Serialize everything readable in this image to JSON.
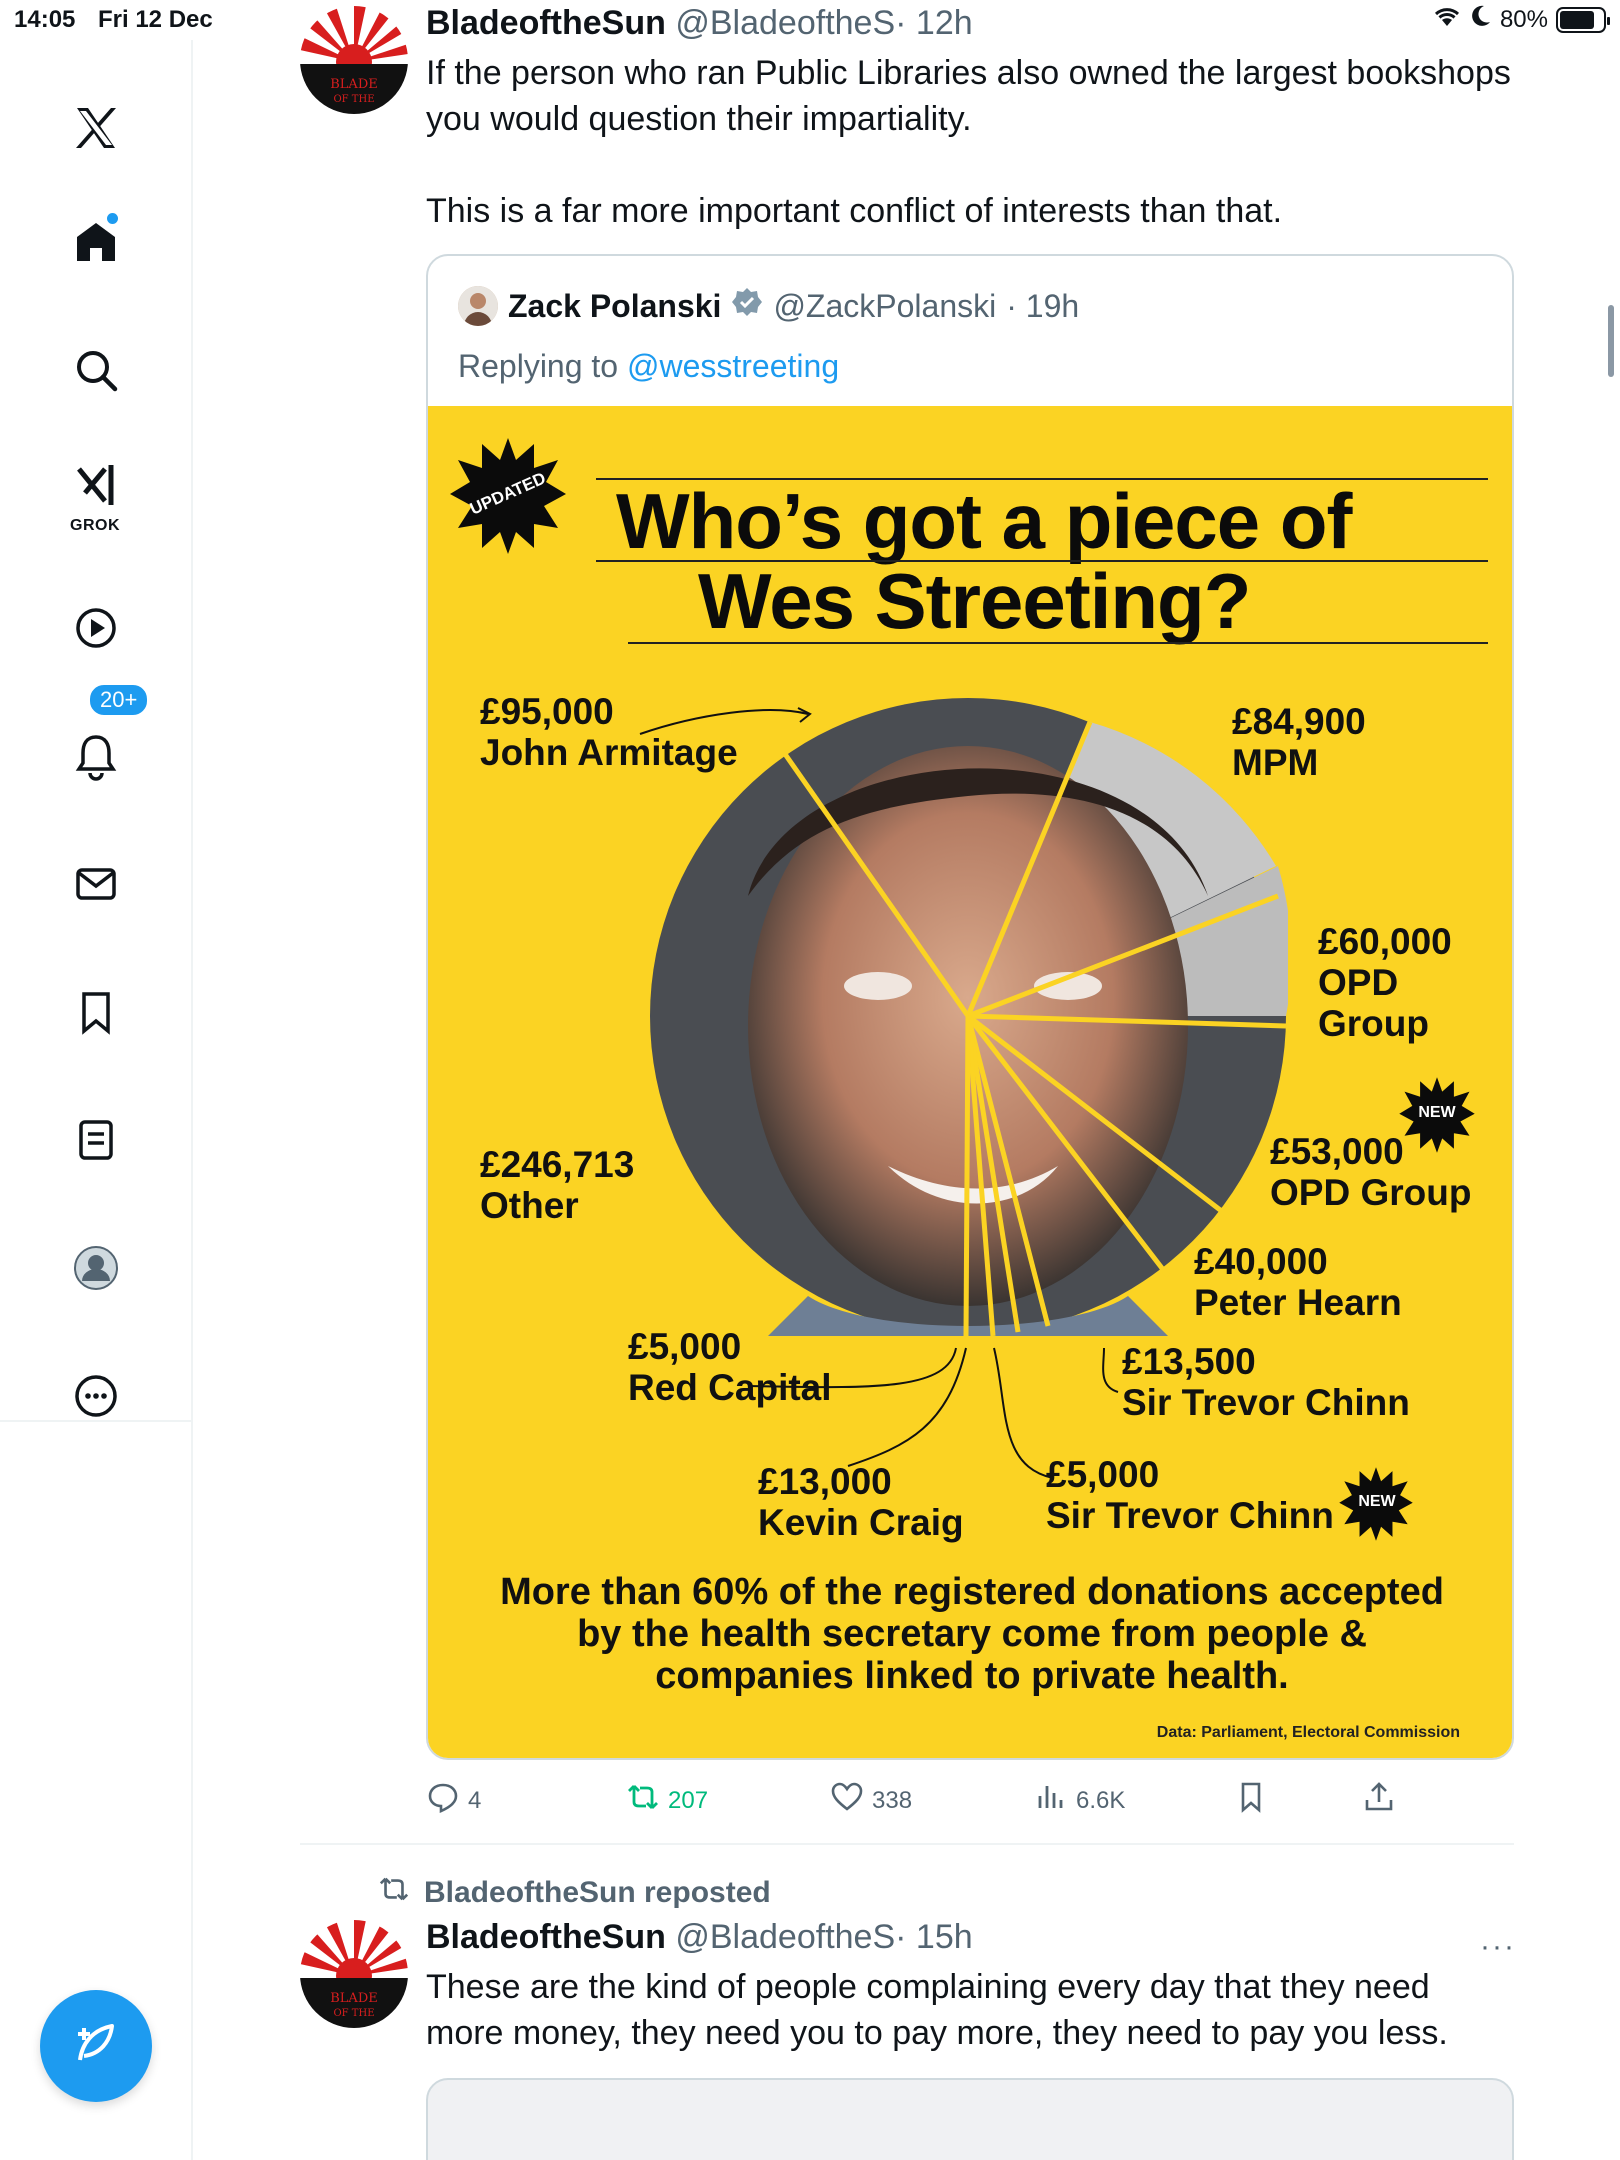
{
  "status_bar": {
    "time": "14:05",
    "date": "Fri 12 Dec",
    "battery": "80%",
    "battery_level": 0.8
  },
  "sidebar": {
    "items": [
      {
        "icon": "x-logo-icon"
      },
      {
        "icon": "home-icon",
        "has_dot": true
      },
      {
        "icon": "search-icon"
      },
      {
        "icon": "grok-icon",
        "label": "GROK"
      },
      {
        "icon": "video-icon"
      },
      {
        "icon": "notifications-icon",
        "badge": "20+"
      },
      {
        "icon": "messages-icon"
      },
      {
        "icon": "bookmarks-icon"
      },
      {
        "icon": "lists-icon"
      },
      {
        "icon": "profile-icon"
      },
      {
        "icon": "more-icon"
      }
    ],
    "compose_icon": "compose-icon"
  },
  "tweet1": {
    "name": "BladeoftheSun",
    "handle": "@BladeoftheS",
    "time": "· 12h",
    "text_line1": "If the person who ran Public Libraries also owned the largest bookshops",
    "text_line2": "you would question their impartiality.",
    "text_line3": "This is a far more important conflict of interests than that.",
    "avatar_text": "BLADE OF THE",
    "quote": {
      "name": "Zack Polanski",
      "handle": "@ZackPolanski",
      "time": "· 19h",
      "replying_prefix": "Replying to",
      "replying_to": "@wesstreeting",
      "poster": {
        "badge": "UPDATED",
        "title_line1": "Who’s got a piece of",
        "title_line2": "Wes Streeting?",
        "labels": [
          {
            "amount": "£95,000",
            "name": "John Armitage"
          },
          {
            "amount": "£84,900",
            "name": "MPM"
          },
          {
            "amount": "£60,000",
            "name": "OPD",
            "name2": "Group"
          },
          {
            "amount": "£53,000",
            "name": "OPD Group",
            "badge": "NEW"
          },
          {
            "amount": "£40,000",
            "name": "Peter Hearn"
          },
          {
            "amount": "£246,713",
            "name": "Other"
          },
          {
            "amount": "£5,000",
            "name": "Red Capital"
          },
          {
            "amount": "£13,500",
            "name": "Sir Trevor Chinn"
          },
          {
            "amount": "£13,000",
            "name": "Kevin Craig"
          },
          {
            "amount": "£5,000",
            "name": "Sir Trevor Chinn",
            "badge": "NEW"
          }
        ],
        "footer_line1": "More than 60% of the registered donations accepted",
        "footer_line2": "by the health secretary come from people &",
        "footer_line3": "companies linked to private health.",
        "source": "Data: Parliament, Electoral Commission"
      }
    },
    "actions": {
      "replies": "4",
      "reposts": "207",
      "likes": "338",
      "views": "6.6K"
    }
  },
  "tweet2": {
    "repost_label": "BladeoftheSun reposted",
    "name": "BladeoftheSun",
    "handle": "@BladeoftheS",
    "time": "· 15h",
    "more": "···",
    "text_line1": "These are the kind of people complaining every day that they need",
    "text_line2": "more money, they need you to pay more, they need to pay you less."
  },
  "colors": {
    "accent": "#1d9bf0",
    "repost_green": "#00ba7c",
    "poster_yellow": "#fbd323",
    "muted": "#536471"
  }
}
